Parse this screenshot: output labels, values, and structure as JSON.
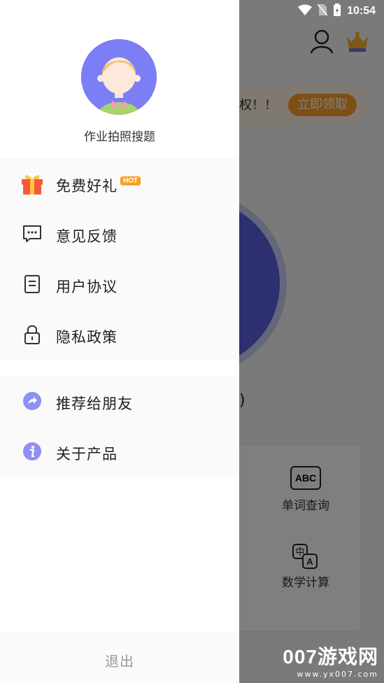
{
  "status_bar": {
    "time": "10:54"
  },
  "background": {
    "banner_text": "权！！",
    "banner_button": "立即领取",
    "version_text": "版)",
    "tools": [
      {
        "label": "单词查询",
        "icon": "abc-icon",
        "icon_text": "ABC"
      },
      {
        "label": "数学计算",
        "icon": "translate-icon",
        "icon_text": "中A"
      }
    ]
  },
  "drawer": {
    "app_name": "作业拍照搜题",
    "group1": [
      {
        "label": "免费好礼",
        "icon": "gift-icon",
        "badge": "HOT"
      },
      {
        "label": "意见反馈",
        "icon": "feedback-icon"
      },
      {
        "label": "用户协议",
        "icon": "document-icon"
      },
      {
        "label": "隐私政策",
        "icon": "lock-icon"
      }
    ],
    "group2": [
      {
        "label": "推荐给朋友",
        "icon": "share-icon"
      },
      {
        "label": "关于产品",
        "icon": "info-icon"
      }
    ],
    "logout": "退出"
  },
  "watermark": {
    "big": "007游戏网",
    "small": "www.yx007.com"
  },
  "colors": {
    "accent": "#7b7ef4",
    "orange": "#ff9f2d",
    "overlay": "rgba(0,0,0,0.5)"
  }
}
